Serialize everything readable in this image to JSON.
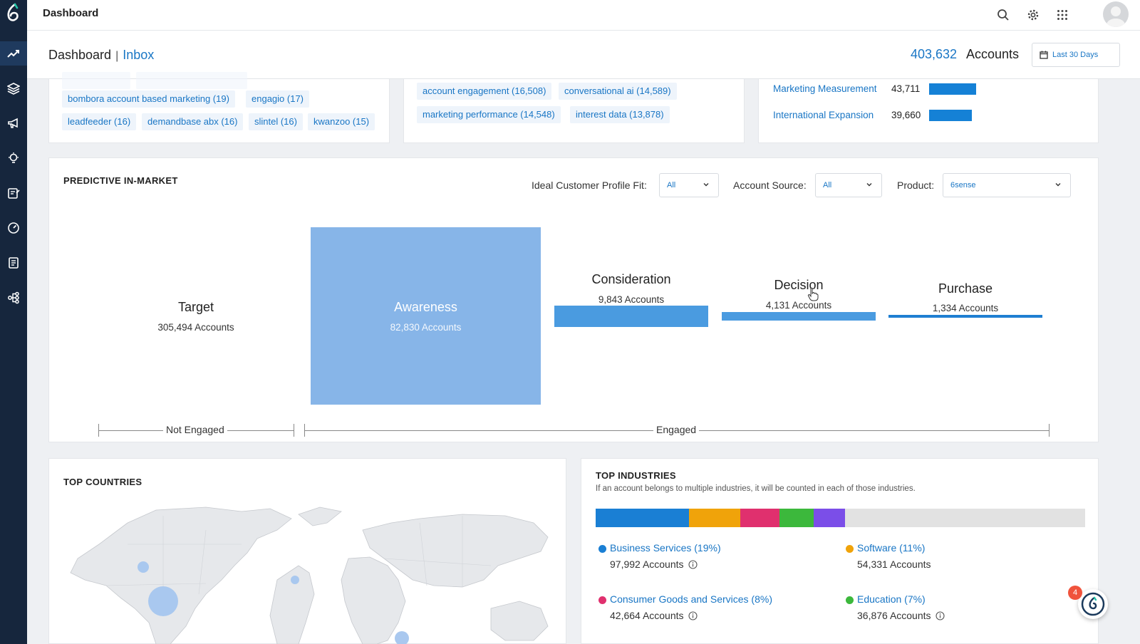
{
  "topbar": {
    "title": "Dashboard"
  },
  "header": {
    "breadcrumb_root": "Dashboard",
    "breadcrumb_separator": "|",
    "breadcrumb_current": "Inbox",
    "account_count": "403,632",
    "account_label": "Accounts",
    "date_range": "Last 30 Days"
  },
  "top_cards": {
    "vendor_tags": [
      {
        "label": "bombora account based marketing (19)"
      },
      {
        "label": "engagio (17)"
      },
      {
        "label": "leadfeeder (16)"
      },
      {
        "label": "demandbase abx (16)"
      },
      {
        "label": "slintel (16)"
      },
      {
        "label": "kwanzoo (15)"
      }
    ],
    "keyword_tags": [
      {
        "label": "account engagement (16,508)"
      },
      {
        "label": "conversational ai (14,589)"
      },
      {
        "label": "marketing performance (14,548)"
      },
      {
        "label": "interest data (13,878)"
      }
    ],
    "topics": [
      {
        "name": "Marketing Measurement",
        "value": "43,711",
        "bar_fraction": 1.0
      },
      {
        "name": "International Expansion",
        "value": "39,660",
        "bar_fraction": 0.907
      }
    ]
  },
  "predictive": {
    "title": "PREDICTIVE IN-MARKET",
    "filters": [
      {
        "label": "Ideal Customer Profile Fit:",
        "value": "All"
      },
      {
        "label": "Account Source:",
        "value": "All"
      },
      {
        "label": "Product:",
        "value": "6sense"
      }
    ],
    "stages": {
      "target": {
        "name": "Target",
        "count": "305,494 Accounts"
      },
      "awareness": {
        "name": "Awareness",
        "count": "82,830 Accounts"
      },
      "consideration": {
        "name": "Consideration",
        "count": "9,843 Accounts"
      },
      "decision": {
        "name": "Decision",
        "count": "4,131 Accounts"
      },
      "purchase": {
        "name": "Purchase",
        "count": "1,334 Accounts"
      }
    },
    "not_engaged_label": "Not Engaged",
    "engaged_label": "Engaged"
  },
  "countries": {
    "title": "TOP COUNTRIES"
  },
  "industries": {
    "title": "TOP INDUSTRIES",
    "subtitle": "If an account belongs to multiple industries, it will be counted in each of those industries.",
    "segments": [
      {
        "share": 0.19,
        "color": "#1a7fd4"
      },
      {
        "share": 0.105,
        "color": "#f0a30a"
      },
      {
        "share": 0.08,
        "color": "#e0306e"
      },
      {
        "share": 0.07,
        "color": "#3cb83c"
      },
      {
        "share": 0.065,
        "color": "#7b4ee8"
      }
    ],
    "items": [
      {
        "name": "Business Services (19%)",
        "count": "97,992 Accounts",
        "color": "#1a7fd4"
      },
      {
        "name": "Software (11%)",
        "count": "54,331 Accounts",
        "color": "#f0a30a"
      },
      {
        "name": "Consumer Goods and Services (8%)",
        "count": "42,664 Accounts",
        "color": "#e0306e"
      },
      {
        "name": "Education (7%)",
        "count": "36,876 Accounts",
        "color": "#3cb83c"
      }
    ]
  },
  "chat": {
    "badge_count": "4"
  }
}
